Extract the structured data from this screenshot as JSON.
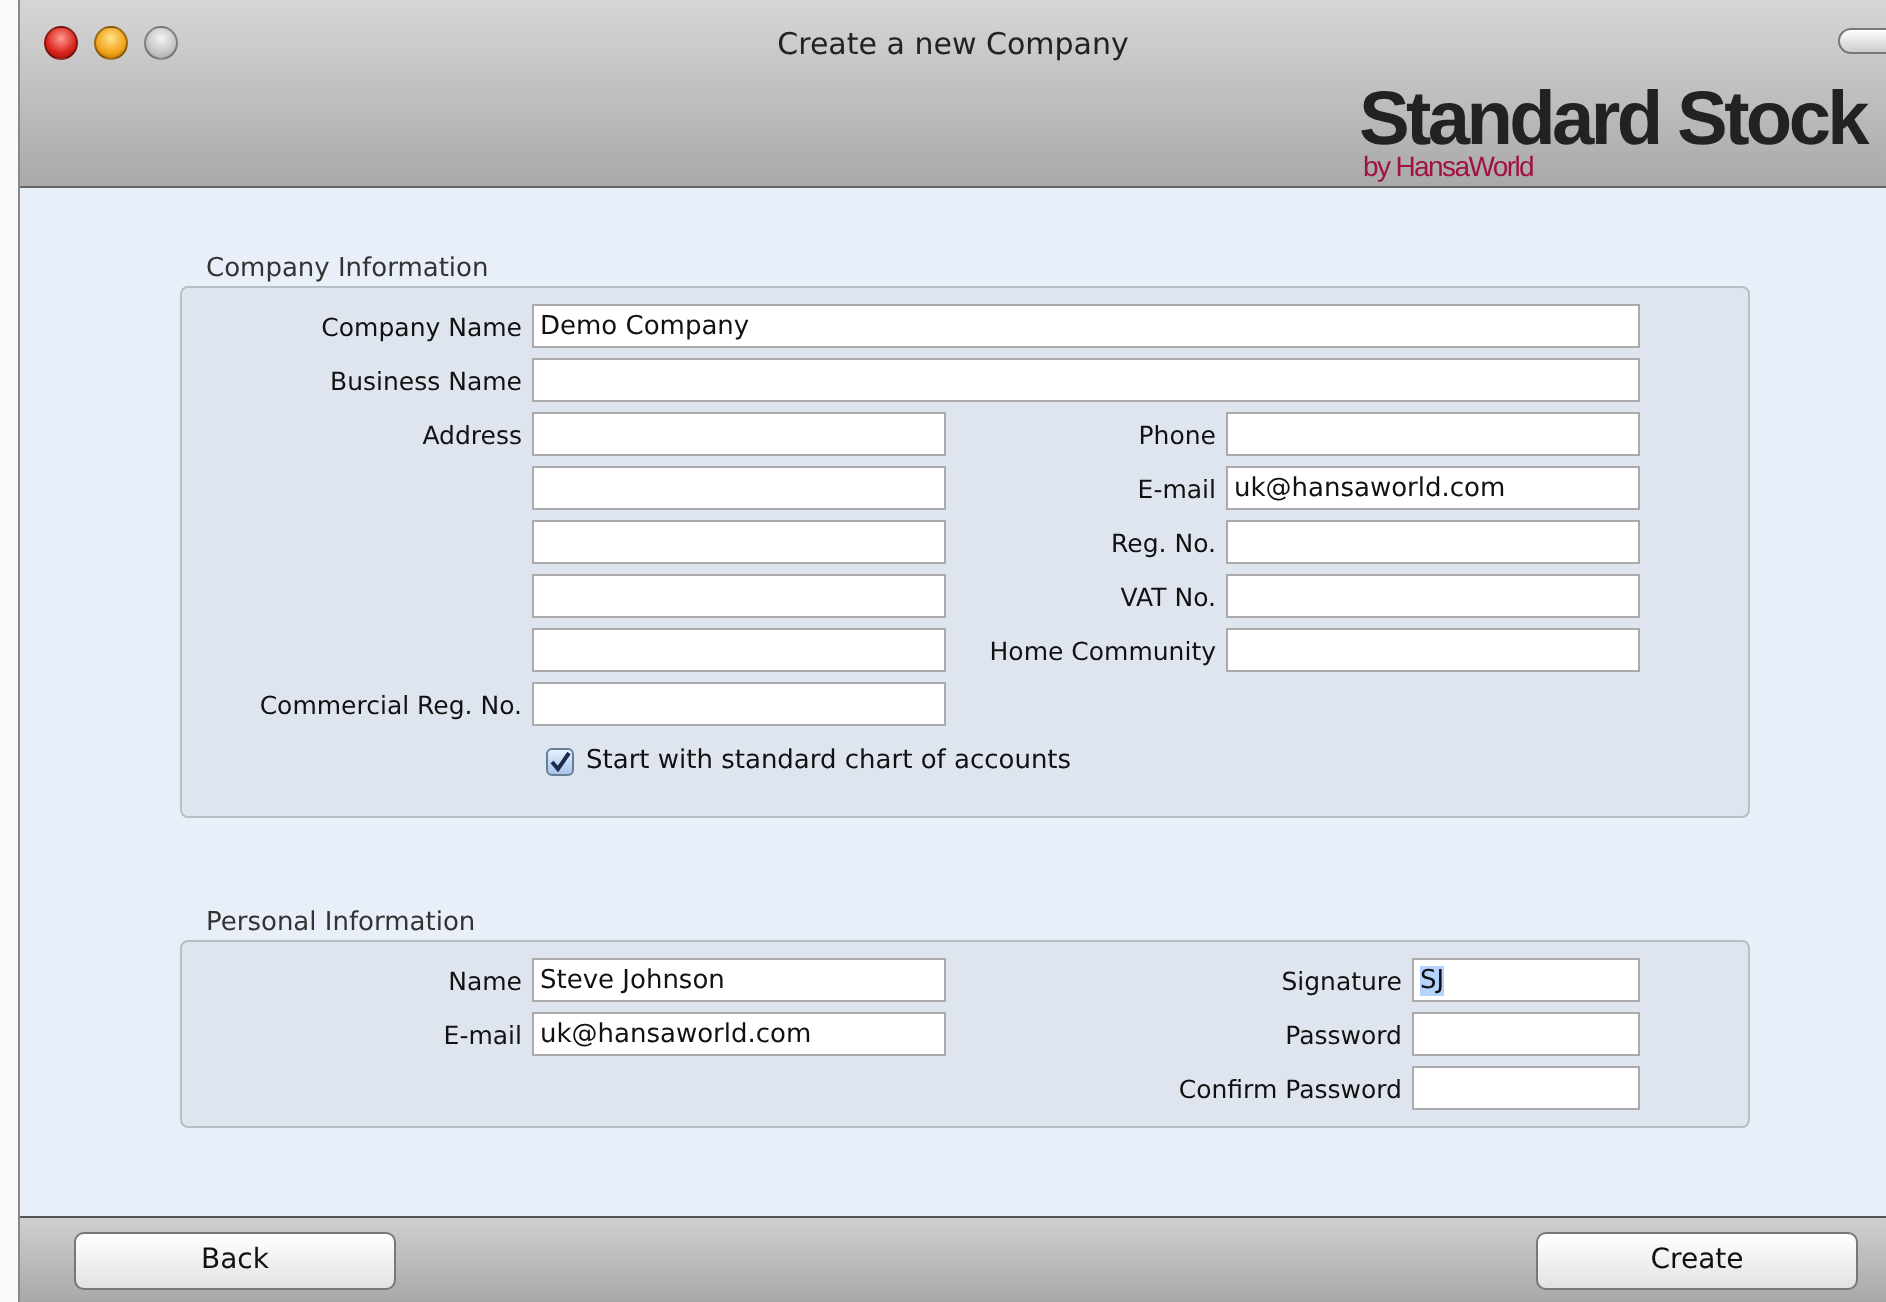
{
  "window": {
    "title": "Create a new Company"
  },
  "logo": {
    "name": "Standard Stock",
    "byline": "by HansaWorld"
  },
  "company_information": {
    "title": "Company Information",
    "rows": [
      {
        "kind": "wide",
        "field": {
          "label": "Company Name",
          "value": "Demo Company"
        }
      },
      {
        "kind": "wide",
        "field": {
          "label": "Business Name"
        }
      },
      {
        "kind": "pair",
        "left": {
          "label": "Address"
        },
        "right": {
          "label": "Phone"
        }
      },
      {
        "kind": "pair",
        "left": {},
        "right": {
          "label": "E-mail",
          "value": "uk@hansaworld.com"
        }
      },
      {
        "kind": "pair",
        "left": {},
        "right": {
          "label": "Reg. No."
        }
      },
      {
        "kind": "pair",
        "left": {},
        "right": {
          "label": "VAT No."
        }
      },
      {
        "kind": "pair",
        "left": {},
        "right": {
          "label": "Home Community"
        }
      },
      {
        "kind": "left",
        "left": {
          "label": "Commercial Reg. No."
        }
      }
    ],
    "checkbox": {
      "label": "Start with standard chart of accounts",
      "checked": true
    }
  },
  "personal_information": {
    "title": "Personal Information",
    "rows": [
      {
        "kind": "pair",
        "left": {
          "label": "Name",
          "value": "Steve Johnson"
        },
        "right": {
          "label": "Signature",
          "value": "SJ",
          "highlighted": true
        }
      },
      {
        "kind": "pair",
        "left": {
          "label": "E-mail",
          "value": "uk@hansaworld.com"
        },
        "right": {
          "label": "Password"
        }
      },
      {
        "kind": "right",
        "right": {
          "label": "Confirm Password"
        }
      }
    ]
  },
  "buttons": [
    "Back",
    "Create"
  ]
}
